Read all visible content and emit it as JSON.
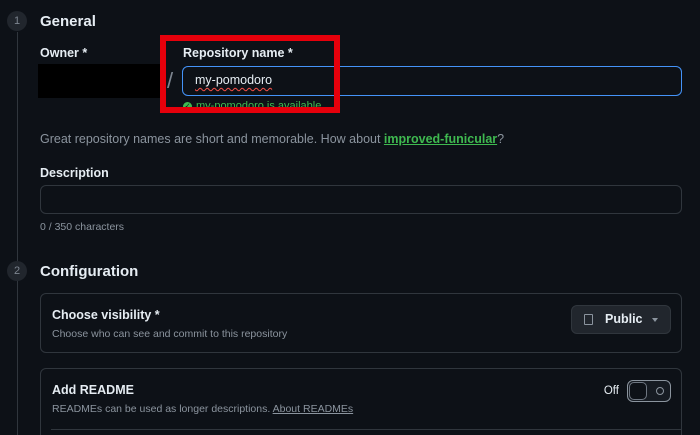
{
  "steps": {
    "general": {
      "number": "1",
      "title": "General"
    },
    "configuration": {
      "number": "2",
      "title": "Configuration"
    }
  },
  "owner": {
    "label": "Owner *"
  },
  "separator": "/",
  "repo_name": {
    "label": "Repository name *",
    "value": "my-pomodoro",
    "availability": "my-pomodoro is available."
  },
  "hint": {
    "prefix": "Great repository names are short and memorable. How about ",
    "suggestion": "improved-funicular",
    "suffix": "?"
  },
  "description": {
    "label": "Description",
    "value": "",
    "counter": "0 / 350 characters"
  },
  "visibility": {
    "title": "Choose visibility *",
    "subtitle": "Choose who can see and commit to this repository",
    "selected": "Public"
  },
  "readme": {
    "title": "Add README",
    "subtitle": "READMEs can be used as longer descriptions. ",
    "link": "About READMEs",
    "toggle_state": "Off"
  },
  "colors": {
    "accent": "#4493f8",
    "success": "#3fb950",
    "highlight": "#e5000b",
    "background": "#0d1117"
  }
}
